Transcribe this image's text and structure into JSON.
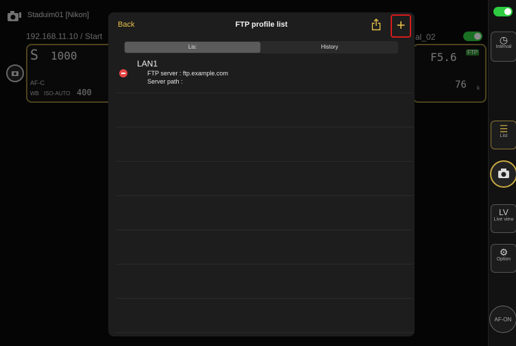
{
  "background": {
    "camera_name": "Staduim01 [Nikon]",
    "camera_ip": "192.168.11.10 / Start",
    "profile_suffix": "al_02",
    "shutter": "1000",
    "mode": "S",
    "af": "AF-C",
    "iso": "ISO-AUTO",
    "shots": "400",
    "aperture": "F5.6",
    "remaining": "76",
    "remaining_unit": "k",
    "ftp_badge": "FTP",
    "wb": "WB"
  },
  "sidebar": {
    "interval_label": "Interval",
    "list_label": "List",
    "lv_label": "LV",
    "liveview_label": "Live view",
    "option_label": "Option",
    "afon_label": "AF-ON"
  },
  "modal": {
    "back_label": "Back",
    "title": "FTP profile list",
    "add_label": "+",
    "tabs": [
      {
        "label": "Lis:",
        "active": true
      },
      {
        "label": "History",
        "active": false
      }
    ],
    "profiles": [
      {
        "name": "LAN1",
        "server_line": "FTP server : ftp.example.com",
        "path_line": "Server path :"
      }
    ]
  },
  "colors": {
    "accent": "#e6c14a",
    "highlight": "#d71b1b",
    "delete": "#e64545",
    "toggle": "#2ecc40"
  }
}
